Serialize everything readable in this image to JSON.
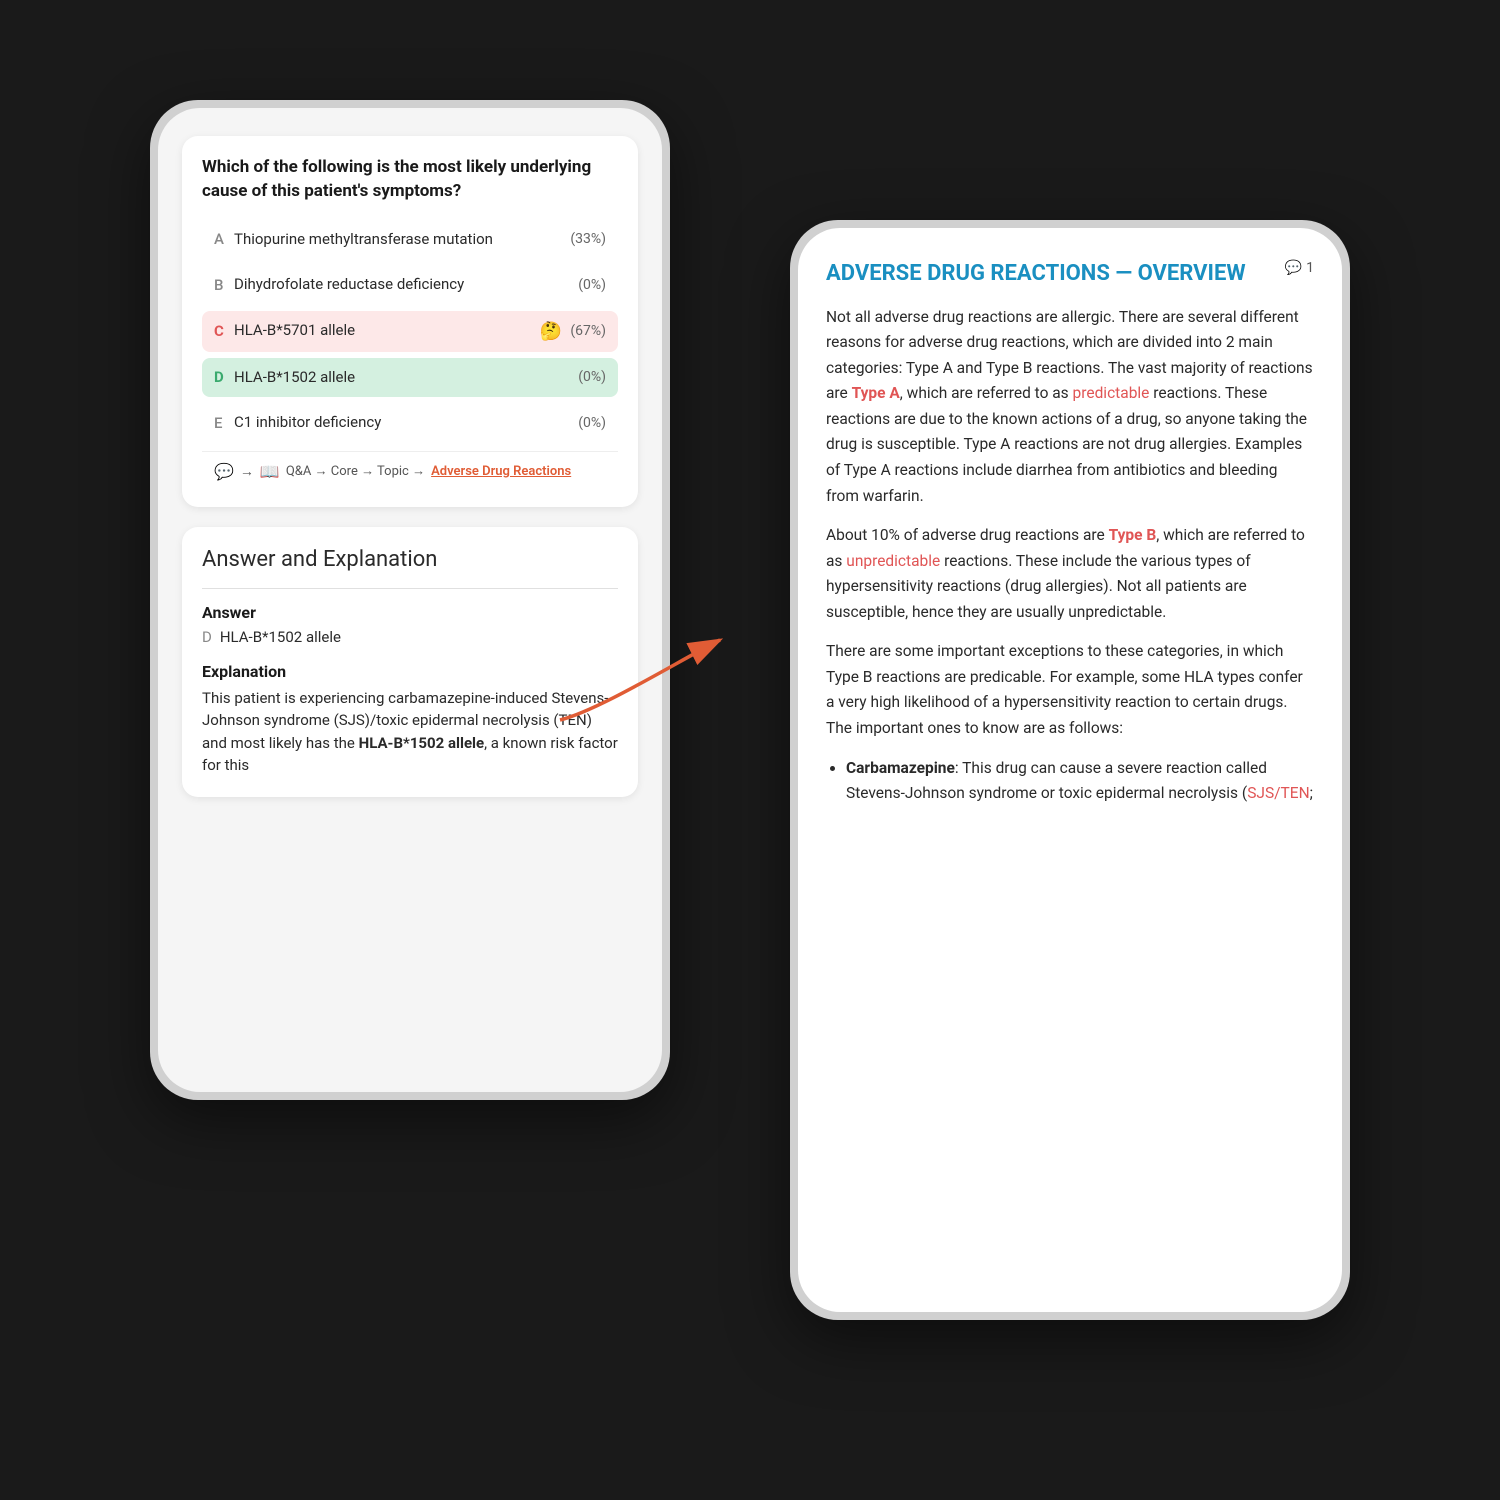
{
  "left_phone": {
    "question": {
      "text": "Which of the following is the most likely underlying cause of this patient's symptoms?",
      "options": [
        {
          "letter": "A",
          "text": "Thiopurine methyltransferase mutation",
          "pct": "(33%)",
          "style": "normal"
        },
        {
          "letter": "B",
          "text": "Dihydrofolate reductase deficiency",
          "pct": "(0%)",
          "style": "normal"
        },
        {
          "letter": "C",
          "text": "HLA-B*5701 allele",
          "pct": "(67%)",
          "style": "red",
          "emoji": "🤔"
        },
        {
          "letter": "D",
          "text": "HLA-B*1502 allele",
          "pct": "(0%)",
          "style": "green"
        },
        {
          "letter": "E",
          "text": "C1 inhibitor deficiency",
          "pct": "(0%)",
          "style": "normal"
        }
      ],
      "breadcrumb": {
        "path": "Q&A → Core → Topic →",
        "link": "Adverse Drug Reactions"
      }
    },
    "answer_section": {
      "title": "Answer and Explanation",
      "answer_label": "Answer",
      "answer_letter": "D",
      "answer_text": "HLA-B*1502 allele",
      "explanation_label": "Explanation",
      "explanation_text": "This patient is experiencing carbamazepine-induced Stevens-Johnson syndrome (SJS)/toxic epidermal necrolysis (TEN) and most likely has the ",
      "explanation_bold": "HLA-B*1502 allele",
      "explanation_rest": ", a known risk factor for this"
    }
  },
  "right_phone": {
    "article": {
      "title": "ADVERSE DRUG REACTIONS — OVERVIEW",
      "badge_icon": "💬",
      "badge_number": "1",
      "paragraphs": [
        "Not all adverse drug reactions are allergic. There are several different reasons for adverse drug reactions, which are divided into 2 main categories: Type A and Type B reactions. The vast majority of reactions are Type A, which are referred to as predictable reactions. These reactions are due to the known actions of a drug, so anyone taking the drug is susceptible. Type A reactions are not drug allergies. Examples of Type A reactions include diarrhea from antibiotics and bleeding from warfarin.",
        "About 10% of adverse drug reactions are Type B, which are referred to as unpredictable reactions. These include the various types of hypersensitivity reactions (drug allergies). Not all patients are susceptible, hence they are usually unpredictable.",
        "There are some important exceptions to these categories, in which Type B reactions are predicable. For example, some HLA types confer a very high likelihood of a hypersensitivity reaction to certain drugs. The important ones to know are as follows:"
      ],
      "bullet_items": [
        {
          "bold": "Carbamazepine",
          "text": ": This drug can cause a severe reaction called Stevens-Johnson syndrome or toxic epidermal necrolysis (SJS/TEN;"
        }
      ]
    }
  },
  "arrow": {
    "color": "#e05c35"
  }
}
